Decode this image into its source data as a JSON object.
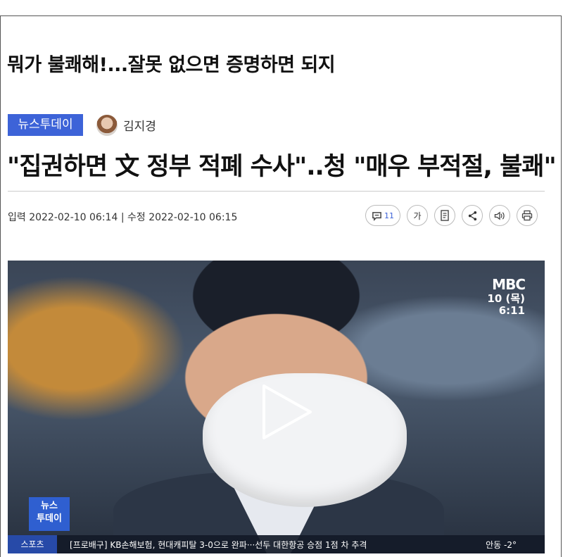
{
  "headline_top": "뭐가 불쾌해!...잘못 없으면 증명하면 되지",
  "section_badge": "뉴스투데이",
  "author_name": "김지경",
  "article_title": "\"집권하면 文 정부 적폐 수사\"..청 \"매우 부적절, 불쾌\"",
  "dates": "입력 2022-02-10 06:14 | 수정 2022-02-10 06:15",
  "tools": {
    "comment_count": "11",
    "font_size_label": "가",
    "icons": [
      "comment-icon",
      "font-size-icon",
      "document-icon",
      "share-icon",
      "speaker-icon",
      "print-icon"
    ]
  },
  "video": {
    "broadcaster": "MBC",
    "date": "10 (목)",
    "time": "6:11",
    "program_logo_line1": "뉴스",
    "program_logo_line2": "투데이",
    "ticker_category": "스포츠",
    "ticker_text": "[프로배구] KB손해보험, 현대캐피탈 3-0으로 완파···선두 대한항공 승점 1점 차 추격",
    "ticker_weather": "안동 -2°"
  },
  "colors": {
    "badge": "#3d63d8",
    "accent": "#3d63d8"
  }
}
